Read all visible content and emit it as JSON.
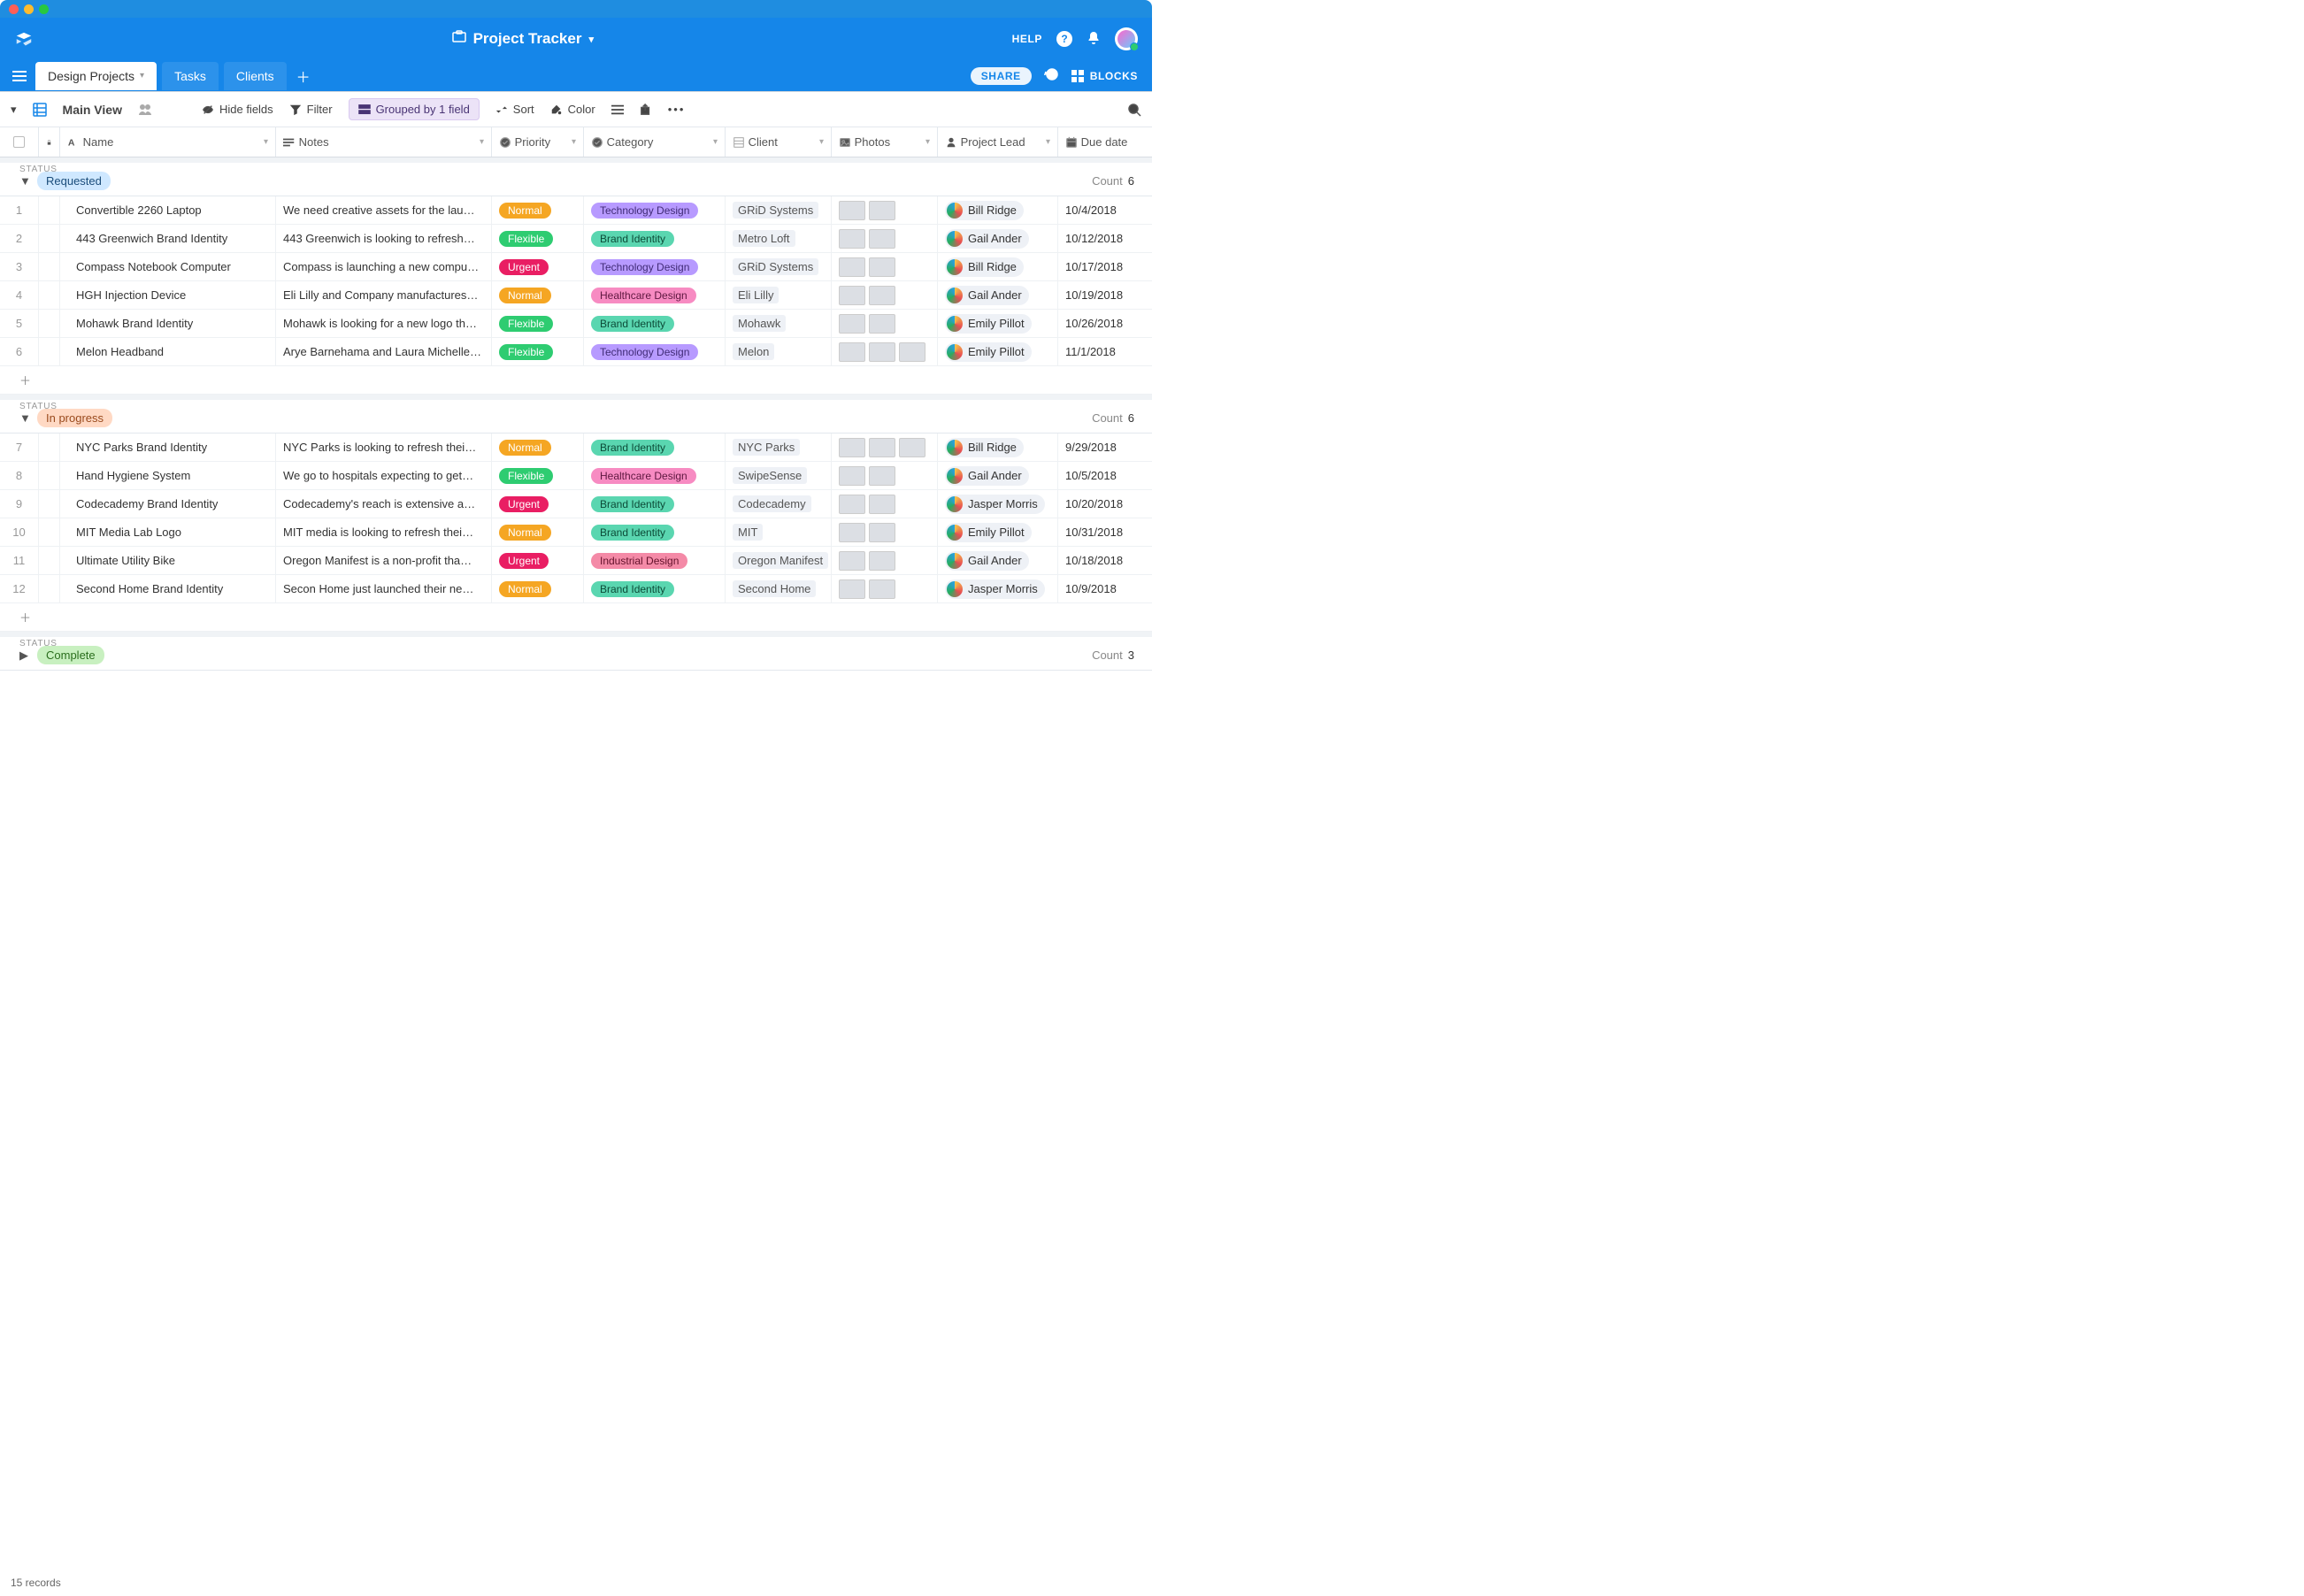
{
  "app": {
    "title": "Project Tracker",
    "help_label": "HELP"
  },
  "tabs": [
    {
      "label": "Design Projects",
      "active": true
    },
    {
      "label": "Tasks",
      "active": false
    },
    {
      "label": "Clients",
      "active": false
    }
  ],
  "topbar_right": {
    "share_label": "SHARE",
    "blocks_label": "BLOCKS"
  },
  "toolbar": {
    "view_name": "Main View",
    "hide_fields": "Hide fields",
    "filter": "Filter",
    "grouped": "Grouped by 1 field",
    "sort": "Sort",
    "color": "Color"
  },
  "columns": {
    "name": "Name",
    "notes": "Notes",
    "priority": "Priority",
    "category": "Category",
    "client": "Client",
    "photos": "Photos",
    "lead": "Project Lead",
    "due": "Due date"
  },
  "status_label": "STATUS",
  "count_label": "Count",
  "groups": [
    {
      "name": "Requested",
      "pill_bg": "#cfe8ff",
      "pill_color": "#1a4c7a",
      "count": 6,
      "expanded": true,
      "rows": [
        {
          "n": 1,
          "name": "Convertible 2260 Laptop",
          "notes": "We need creative assets for the lau…",
          "priority": "Normal",
          "category": "Technology Design",
          "client": "GRiD Systems",
          "lead": "Bill Ridge",
          "due": "10/4/2018",
          "thumbs": 2
        },
        {
          "n": 2,
          "name": "443 Greenwich Brand Identity",
          "notes": "443 Greenwich is looking to refresh…",
          "priority": "Flexible",
          "category": "Brand Identity",
          "client": "Metro Loft",
          "lead": "Gail Ander",
          "due": "10/12/2018",
          "thumbs": 2
        },
        {
          "n": 3,
          "name": "Compass Notebook Computer",
          "notes": "Compass is launching a new compu…",
          "priority": "Urgent",
          "category": "Technology Design",
          "client": "GRiD Systems",
          "lead": "Bill Ridge",
          "due": "10/17/2018",
          "thumbs": 2
        },
        {
          "n": 4,
          "name": "HGH Injection Device",
          "notes": "Eli Lilly and Company manufactures…",
          "priority": "Normal",
          "category": "Healthcare Design",
          "client": "Eli Lilly",
          "lead": "Gail Ander",
          "due": "10/19/2018",
          "thumbs": 2
        },
        {
          "n": 5,
          "name": "Mohawk Brand Identity",
          "notes": "Mohawk is looking for a new logo th…",
          "priority": "Flexible",
          "category": "Brand Identity",
          "client": "Mohawk",
          "lead": "Emily Pillot",
          "due": "10/26/2018",
          "thumbs": 2
        },
        {
          "n": 6,
          "name": "Melon Headband",
          "notes": "Arye Barnehama and Laura Michelle…",
          "priority": "Flexible",
          "category": "Technology Design",
          "client": "Melon",
          "lead": "Emily Pillot",
          "due": "11/1/2018",
          "thumbs": 3
        }
      ]
    },
    {
      "name": "In progress",
      "pill_bg": "#ffd9c4",
      "pill_color": "#9a4a1d",
      "count": 6,
      "expanded": true,
      "rows": [
        {
          "n": 7,
          "name": "NYC Parks Brand Identity",
          "notes": "NYC Parks is looking to refresh thei…",
          "priority": "Normal",
          "category": "Brand Identity",
          "client": "NYC Parks",
          "lead": "Bill Ridge",
          "due": "9/29/2018",
          "thumbs": 3
        },
        {
          "n": 8,
          "name": "Hand Hygiene System",
          "notes": "We go to hospitals expecting to get…",
          "priority": "Flexible",
          "category": "Healthcare Design",
          "client": "SwipeSense",
          "lead": "Gail Ander",
          "due": "10/5/2018",
          "thumbs": 2
        },
        {
          "n": 9,
          "name": "Codecademy Brand Identity",
          "notes": "Codecademy's reach is extensive a…",
          "priority": "Urgent",
          "category": "Brand Identity",
          "client": "Codecademy",
          "lead": "Jasper Morris",
          "due": "10/20/2018",
          "thumbs": 2
        },
        {
          "n": 10,
          "name": "MIT Media Lab Logo",
          "notes": "MIT media is looking to refresh thei…",
          "priority": "Normal",
          "category": "Brand Identity",
          "client": "MIT",
          "lead": "Emily Pillot",
          "due": "10/31/2018",
          "thumbs": 2
        },
        {
          "n": 11,
          "name": "Ultimate Utility Bike",
          "notes": "Oregon Manifest is a non-profit tha…",
          "priority": "Urgent",
          "category": "Industrial Design",
          "client": "Oregon Manifest",
          "lead": "Gail Ander",
          "due": "10/18/2018",
          "thumbs": 2
        },
        {
          "n": 12,
          "name": "Second Home Brand Identity",
          "notes": "Secon Home just launched their ne…",
          "priority": "Normal",
          "category": "Brand Identity",
          "client": "Second Home",
          "lead": "Jasper Morris",
          "due": "10/9/2018",
          "thumbs": 2
        }
      ]
    },
    {
      "name": "Complete",
      "pill_bg": "#c8f0c0",
      "pill_color": "#2a6e1d",
      "count": 3,
      "expanded": false,
      "rows": []
    }
  ],
  "footer": {
    "record_count": "15 records"
  }
}
